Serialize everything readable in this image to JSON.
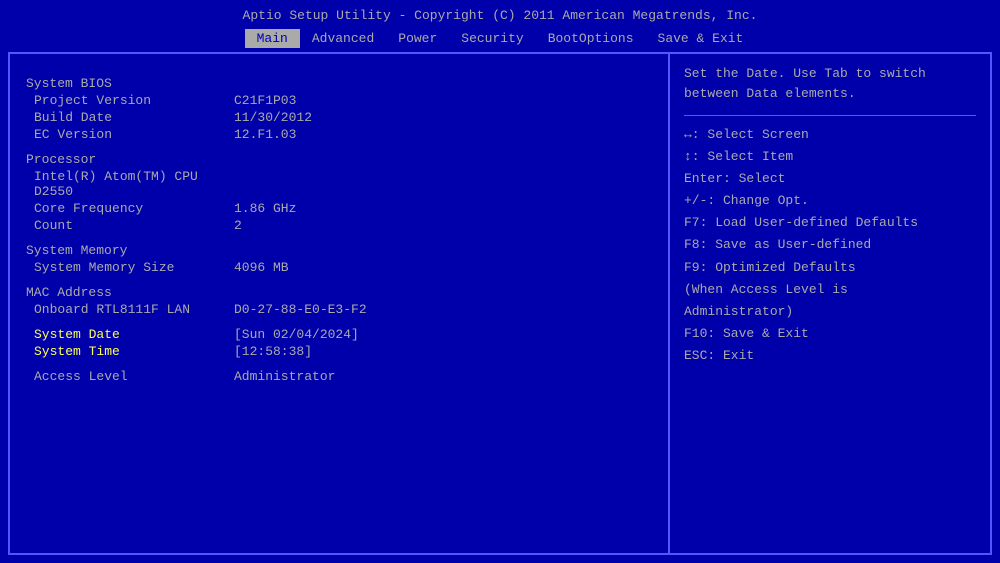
{
  "title": "Aptio Setup Utility - Copyright (C) 2011 American Megatrends, Inc.",
  "menu": {
    "items": [
      {
        "label": "Main",
        "active": true
      },
      {
        "label": "Advanced",
        "active": false
      },
      {
        "label": "Power",
        "active": false
      },
      {
        "label": "Security",
        "active": false
      },
      {
        "label": "BootOptions",
        "active": false
      },
      {
        "label": "Save & Exit",
        "active": false
      }
    ]
  },
  "left": {
    "system_bios": {
      "section_label": "System BIOS",
      "project_version_label": "Project Version",
      "project_version_value": "C21F1P03",
      "build_date_label": "Build Date",
      "build_date_value": "11/30/2012",
      "ec_version_label": "EC Version",
      "ec_version_value": "12.F1.03"
    },
    "processor": {
      "section_label": "Processor",
      "cpu_label": "Intel(R) Atom(TM) CPU D2550",
      "core_freq_label": "Core Frequency",
      "core_freq_value": "1.86 GHz",
      "count_label": "Count",
      "count_value": "2"
    },
    "system_memory": {
      "section_label": "System Memory",
      "size_label": "System Memory Size",
      "size_value": "4096 MB"
    },
    "mac_address": {
      "section_label": "MAC Address",
      "onboard_label": "Onboard RTL8111F LAN",
      "onboard_value": "D0-27-88-E0-E3-F2"
    },
    "system_date": {
      "label": "System Date",
      "value": "[Sun 02/04/2024]"
    },
    "system_time": {
      "label": "System Time",
      "value": "[12:58:38]"
    },
    "access_level": {
      "label": "Access Level",
      "value": "Administrator"
    }
  },
  "right": {
    "hint": "Set the Date. Use Tab to switch between Data elements.",
    "keys": [
      {
        "key": "↔:",
        "desc": "Select Screen"
      },
      {
        "key": "↕:",
        "desc": "Select Item"
      },
      {
        "key": "Enter:",
        "desc": "Select"
      },
      {
        "key": "+/-:",
        "desc": "Change Opt."
      },
      {
        "key": "F7:",
        "desc": "Load User-defined Defaults"
      },
      {
        "key": "F8:",
        "desc": "Save as User-defined"
      },
      {
        "key": "F9:",
        "desc": "Optimized Defaults"
      },
      {
        "key": "",
        "desc": "(When Access Level is"
      },
      {
        "key": "",
        "desc": "Administrator)"
      },
      {
        "key": "F10:",
        "desc": "Save & Exit"
      },
      {
        "key": "ESC:",
        "desc": "Exit"
      }
    ]
  }
}
